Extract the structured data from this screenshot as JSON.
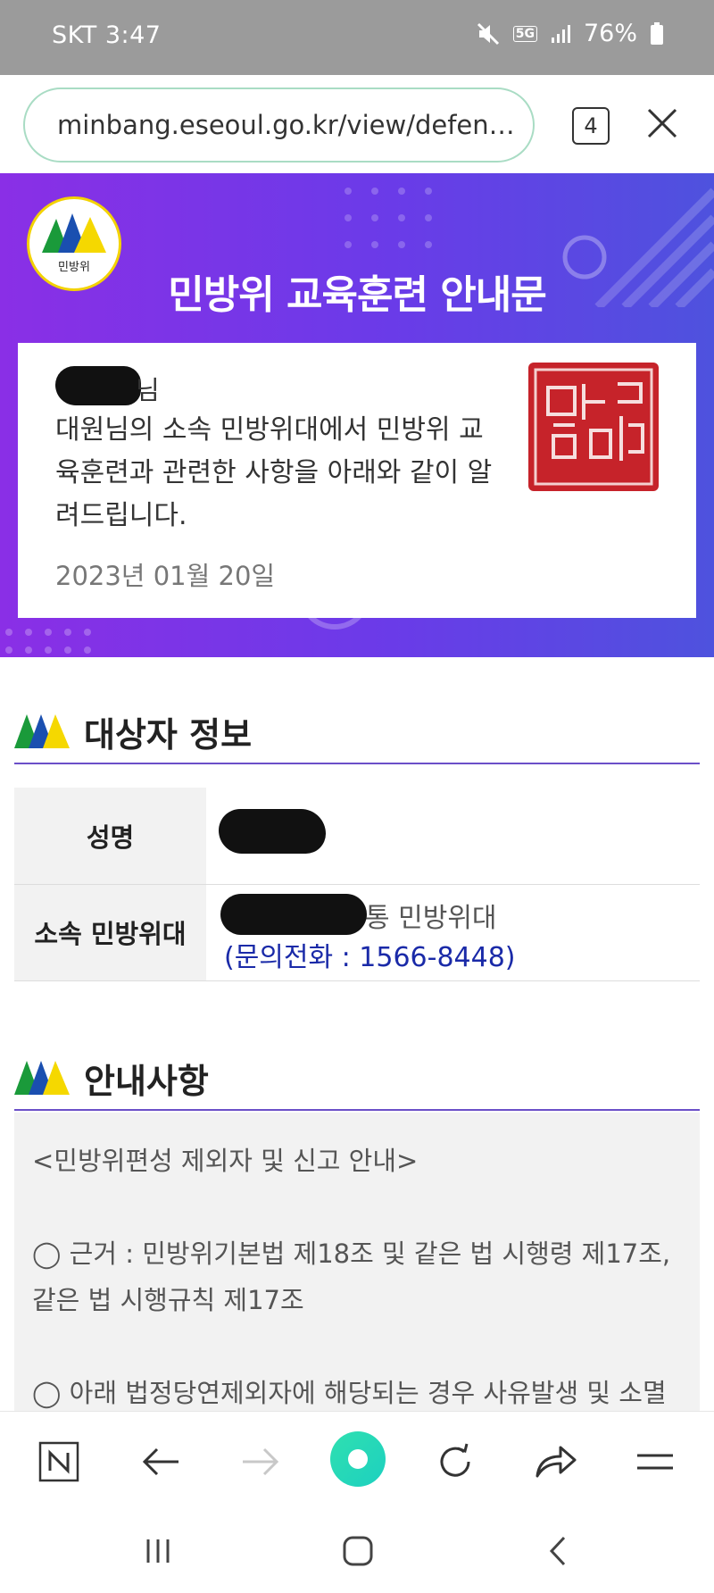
{
  "status_bar": {
    "carrier_time": "SKT 3:47",
    "network": "5G",
    "battery": "76%",
    "icons": [
      "mute-icon",
      "signal-icon",
      "battery-icon"
    ]
  },
  "browser": {
    "url": "minbang.eseoul.go.kr/view/defens...",
    "tab_count": "4",
    "toolbar_icons": [
      "naver-icon",
      "back-icon",
      "forward-icon",
      "home-icon",
      "reload-icon",
      "share-icon",
      "menu-icon"
    ],
    "nav_icons": [
      "recent-apps-icon",
      "home-icon",
      "back-icon"
    ]
  },
  "banner": {
    "logo_text": "민방위",
    "title": "민방위 교육훈련 안내문"
  },
  "notice": {
    "name_suffix": "님",
    "body": "대원님의 소속 민방위대에서 민방위 교육훈련과 관련한 사항을 아래와 같이 알려드립니다.",
    "date": "2023년 01월 20일"
  },
  "target_info": {
    "section_title": "대상자 정보",
    "rows": [
      {
        "label": "성명",
        "value": ""
      },
      {
        "label": "소속 민방위대",
        "unit_suffix": "통 민방위대",
        "phone": "(문의전화 : 1566-8448)"
      }
    ]
  },
  "guide": {
    "section_title": "안내사항",
    "lines": [
      "<민방위편성 제외자 및 신고 안내>",
      "◯ 근거 : 민방위기본법 제18조 및 같은 법 시행령 제17조, 같은 법 시행규칙 제17조",
      "◯ 아래 법정당연제외자에 해당되는 경우 사유발생 및 소멸"
    ]
  },
  "colors": {
    "banner_start": "#8a2fe6",
    "banner_end": "#4e52de",
    "phone_text": "#1a2aa8",
    "section_rule": "#6b4fc8"
  }
}
